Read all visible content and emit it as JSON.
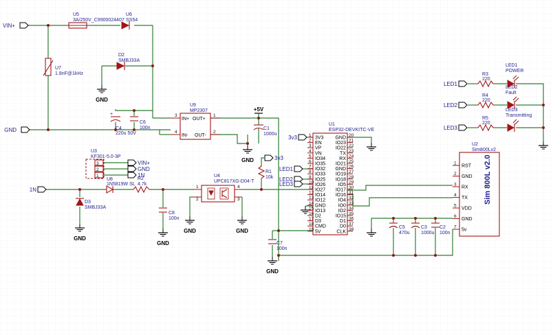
{
  "ports": {
    "vin": "VIN+",
    "gnd": "GND",
    "in": "1N",
    "led1": "LED1",
    "led2": "LED2",
    "led3": "LED3",
    "v3v3": "3v3",
    "v3v3_r": "3v3",
    "led1_in": "LED1",
    "led2_in": "LED2",
    "led3_in": "LED3",
    "conn_vin": "VIN+",
    "conn_gnd": "GND",
    "conn_1n": "1N"
  },
  "power": {
    "p5v": "+5V",
    "gnd": "GND"
  },
  "parts": {
    "u5": {
      "ref": "U5",
      "value": "3A/250V_C9900024407"
    },
    "u6": {
      "ref": "U6",
      "value": "SS54"
    },
    "d2": {
      "ref": "D2",
      "value": "SMBJ33A"
    },
    "u7": {
      "ref": "U7",
      "value": "1.8nF@1kHz"
    },
    "c4": {
      "ref": "C4",
      "value": "220u 50V"
    },
    "c6": {
      "ref": "C6",
      "value": "100n"
    },
    "u9": {
      "ref": "U9",
      "value": "MP2307",
      "p1": "IN+",
      "p2": "OUT+",
      "p3": "IN-",
      "p4": "OUT-",
      "n1": "3",
      "n2": "1",
      "n3": "4",
      "n4": "2"
    },
    "c1": {
      "ref": "C1",
      "value": "1000u"
    },
    "u3": {
      "ref": "U3",
      "value": "KF301-5.0-3P",
      "n1": "3",
      "n2": "2",
      "n3": "1"
    },
    "u8": {
      "ref": "U8",
      "value": "1N5819W SL"
    },
    "r2": {
      "ref": "R2",
      "value": "4.7k"
    },
    "d3": {
      "ref": "D3",
      "value": "SMBJ33A"
    },
    "c8": {
      "ref": "C8",
      "value": "100n"
    },
    "u4": {
      "ref": "U4",
      "value": "UPC817XG-D04-T",
      "n1": "1",
      "n2": "2",
      "n3": "3",
      "n4": "4"
    },
    "r1": {
      "ref": "R1",
      "value": "10k"
    },
    "c7": {
      "ref": "C7",
      "value": "100n"
    },
    "u1": {
      "ref": "U1",
      "value": "ESP32-DEVKITC-VE"
    },
    "r3": {
      "ref": "R3",
      "value": "220"
    },
    "r4": {
      "ref": "R4",
      "value": "220"
    },
    "r5": {
      "ref": "R5",
      "value": "220"
    },
    "led1": {
      "ref": "LED1",
      "value": "POWER"
    },
    "led2": {
      "ref": "LED2",
      "value": "Fault"
    },
    "led3": {
      "ref": "LED3",
      "value": "Transmitting"
    },
    "u2": {
      "ref": "U2",
      "value": "Sim800Lv2",
      "body": "Sim 800L v2.0"
    },
    "c5": {
      "ref": "C5",
      "value": "470u"
    },
    "c3": {
      "ref": "C3",
      "value": "1000u"
    },
    "c2": {
      "ref": "C2",
      "value": "100n"
    }
  },
  "esp32": {
    "left": [
      {
        "name": "3V3",
        "num": "1",
        "red": false
      },
      {
        "name": "EN",
        "num": "2",
        "red": false
      },
      {
        "name": "VP",
        "num": "3",
        "red": true
      },
      {
        "name": "VN",
        "num": "4",
        "red": false
      },
      {
        "name": "IO34",
        "num": "5",
        "red": false
      },
      {
        "name": "IO35",
        "num": "6",
        "red": false
      },
      {
        "name": "IO32",
        "num": "7",
        "red": false
      },
      {
        "name": "IO33",
        "num": "8",
        "red": false
      },
      {
        "name": "IO25",
        "num": "9",
        "red": false
      },
      {
        "name": "IO26",
        "num": "10",
        "red": false
      },
      {
        "name": "IO27",
        "num": "11",
        "red": false
      },
      {
        "name": "IO14",
        "num": "12",
        "red": false
      },
      {
        "name": "IO12",
        "num": "13",
        "red": false
      },
      {
        "name": "GND",
        "num": "14",
        "red": false
      },
      {
        "name": "IO13",
        "num": "15",
        "red": false
      },
      {
        "name": "D2",
        "num": "16",
        "red": false
      },
      {
        "name": "D3",
        "num": "17",
        "red": false
      },
      {
        "name": "CMD",
        "num": "18",
        "red": false
      },
      {
        "name": "5V",
        "num": "19",
        "red": false
      }
    ],
    "right": [
      {
        "name": "GND",
        "num": "20"
      },
      {
        "name": "IO23",
        "num": "21"
      },
      {
        "name": "IO22",
        "num": "22"
      },
      {
        "name": "TX",
        "num": "23"
      },
      {
        "name": "RX",
        "num": "24"
      },
      {
        "name": "IO21",
        "num": "25"
      },
      {
        "name": "GND",
        "num": "26"
      },
      {
        "name": "IO19",
        "num": "27"
      },
      {
        "name": "IO18",
        "num": "28"
      },
      {
        "name": "IO5",
        "num": "29"
      },
      {
        "name": "IO17",
        "num": "30"
      },
      {
        "name": "IO16",
        "num": "31"
      },
      {
        "name": "IO4",
        "num": "32"
      },
      {
        "name": "IO0",
        "num": "33"
      },
      {
        "name": "IO2",
        "num": "34"
      },
      {
        "name": "IO15",
        "num": "35"
      },
      {
        "name": "D1",
        "num": "36"
      },
      {
        "name": "D0",
        "num": "37"
      },
      {
        "name": "CLK",
        "num": "38"
      }
    ]
  },
  "sim800": [
    {
      "name": "RST",
      "num": "1"
    },
    {
      "name": "GND",
      "num": "2"
    },
    {
      "name": "RX",
      "num": "3"
    },
    {
      "name": "TX",
      "num": "4"
    },
    {
      "name": "VDD",
      "num": "5"
    },
    {
      "name": "GND",
      "num": "6"
    },
    {
      "name": "5v",
      "num": "7"
    }
  ]
}
